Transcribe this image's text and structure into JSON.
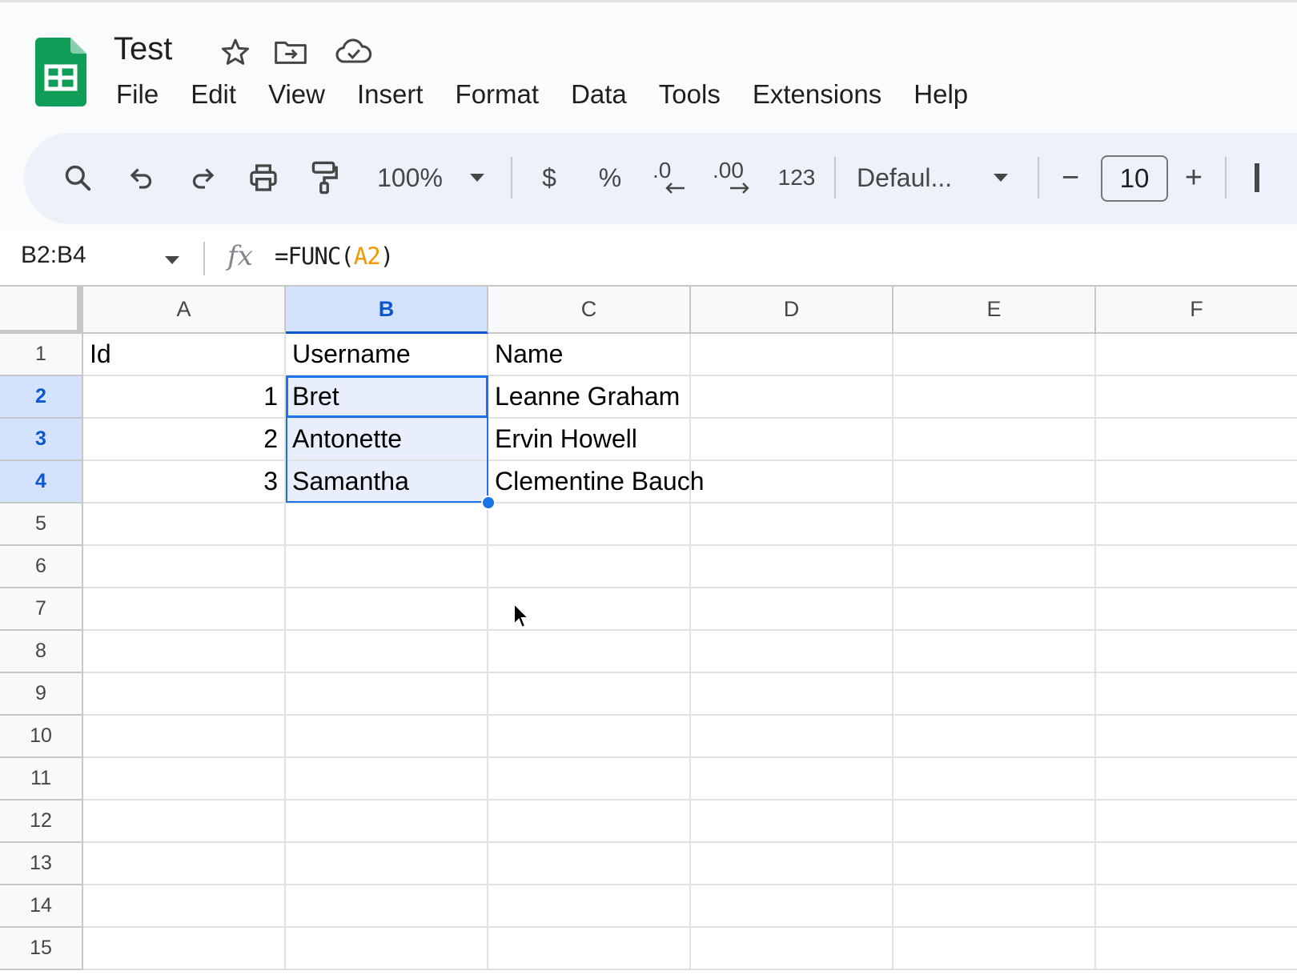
{
  "document": {
    "title": "Test"
  },
  "header_icons": [
    "star-icon",
    "move-to-folder-icon",
    "cloud-saved-icon"
  ],
  "menu": [
    "File",
    "Edit",
    "View",
    "Insert",
    "Format",
    "Data",
    "Tools",
    "Extensions",
    "Help"
  ],
  "toolbar": {
    "zoom": "100%",
    "currency": "$",
    "percent": "%",
    "decrease_decimal": ".0",
    "increase_decimal": ".00",
    "more_formats": "123",
    "font": "Defaul...",
    "font_size": "10",
    "minus": "−",
    "plus": "+"
  },
  "formula_bar": {
    "name_box": "B2:B4",
    "fx": "fx",
    "formula_prefix": "=FUNC(",
    "formula_ref": "A2",
    "formula_suffix": ")"
  },
  "grid": {
    "columns": [
      "A",
      "B",
      "C",
      "D",
      "E",
      "F"
    ],
    "selected_column": "B",
    "rows": [
      "1",
      "2",
      "3",
      "4",
      "5",
      "6",
      "7",
      "8",
      "9",
      "10",
      "11",
      "12",
      "13",
      "14",
      "15"
    ],
    "selected_rows": [
      "2",
      "3",
      "4"
    ],
    "cells": [
      [
        "Id",
        "Username",
        "Name"
      ],
      [
        "1",
        "Bret",
        "Leanne Graham"
      ],
      [
        "2",
        "Antonette",
        "Ervin Howell"
      ],
      [
        "3",
        "Samantha",
        "Clementine Bauch"
      ]
    ]
  },
  "colors": {
    "accent": "#1a73e8",
    "selection_fill": "#e8eefc",
    "header_selected": "#d3e3fd",
    "logo": "#0f9d58",
    "formula_ref": "#f29900"
  }
}
